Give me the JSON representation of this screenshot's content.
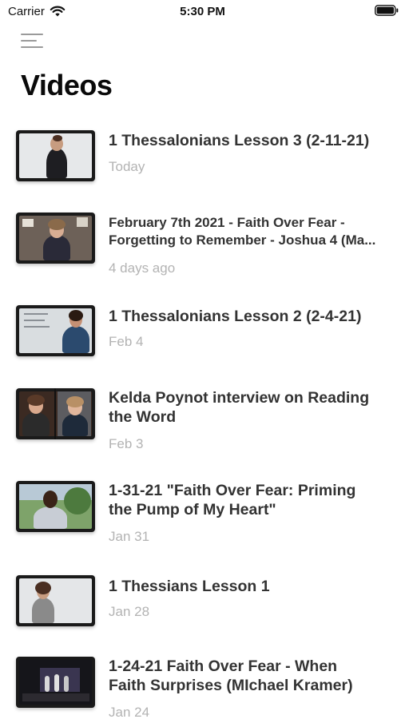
{
  "status_bar": {
    "carrier": "Carrier",
    "time": "5:30 PM"
  },
  "header": {
    "title": "Videos",
    "menu_icon": "hamburger-icon"
  },
  "videos": [
    {
      "title_lines": [
        "1 Thessalonians Lesson 3 (2-11-21)"
      ],
      "date": "Today"
    },
    {
      "title_lines": [
        "February 7th 2021 - Faith Over Fear -",
        "Forgetting to Remember - Joshua 4 (Ma..."
      ],
      "date": "4 days ago"
    },
    {
      "title_lines": [
        "1 Thessalonians Lesson 2 (2-4-21)"
      ],
      "date": "Feb 4"
    },
    {
      "title_lines": [
        "Kelda Poynot interview on Reading",
        "the Word"
      ],
      "date": "Feb 3"
    },
    {
      "title_lines": [
        "1-31-21 \"Faith Over Fear: Priming",
        "the Pump of My Heart\""
      ],
      "date": "Jan 31"
    },
    {
      "title_lines": [
        "1 Thessians Lesson 1"
      ],
      "date": "Jan 28"
    },
    {
      "title_lines": [
        "1-24-21 Faith Over Fear - When",
        "Faith Surprises (MIchael Kramer)"
      ],
      "date": "Jan 24"
    }
  ]
}
